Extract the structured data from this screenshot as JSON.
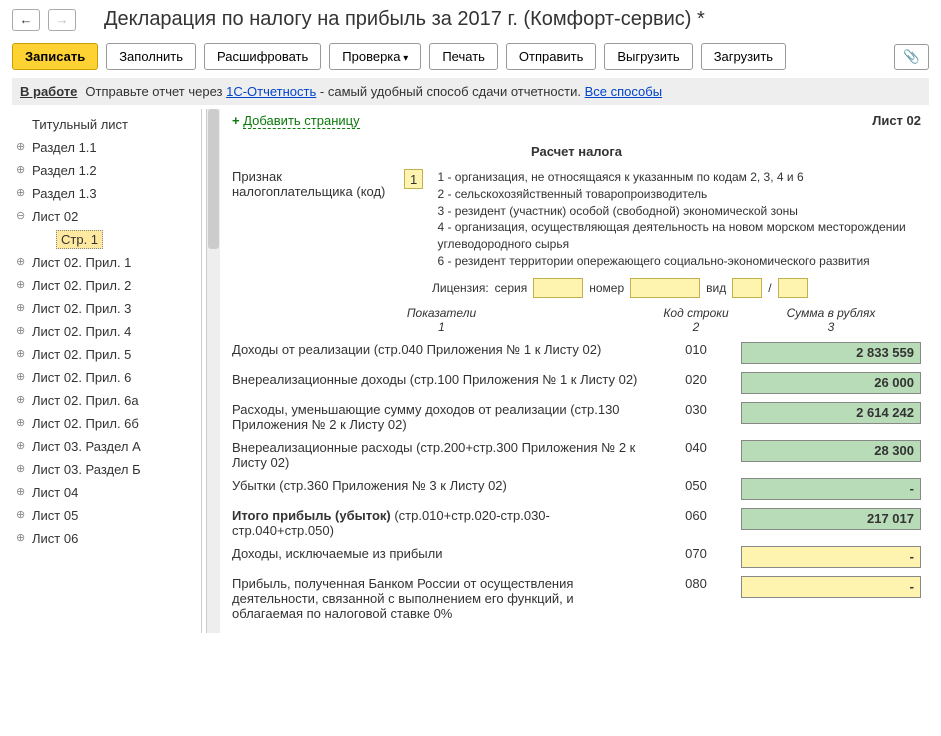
{
  "header": {
    "title": "Декларация по налогу на прибыль за 2017 г. (Комфорт-сервис) *"
  },
  "toolbar": {
    "write": "Записать",
    "fill": "Заполнить",
    "decode": "Расшифровать",
    "check": "Проверка",
    "print": "Печать",
    "send": "Отправить",
    "export": "Выгрузить",
    "import": "Загрузить"
  },
  "status": {
    "label": "В работе",
    "text1": "Отправьте отчет через ",
    "link1": "1С-Отчетность",
    "text2": " - самый удобный способ сдачи отчетности. ",
    "link2": "Все способы"
  },
  "sidebar": {
    "items": [
      "Титульный лист",
      "Раздел 1.1",
      "Раздел 1.2",
      "Раздел 1.3",
      "Лист 02",
      "Стр. 1",
      "Лист 02. Прил. 1",
      "Лист 02. Прил. 2",
      "Лист 02. Прил. 3",
      "Лист 02. Прил. 4",
      "Лист 02. Прил. 5",
      "Лист 02. Прил. 6",
      "Лист 02. Прил. 6а",
      "Лист 02. Прил. 6б",
      "Лист 03. Раздел А",
      "Лист 03. Раздел Б",
      "Лист 04",
      "Лист 05",
      "Лист 06"
    ]
  },
  "content": {
    "add_page": "Добавить страницу",
    "sheet": "Лист 02",
    "form_title": "Расчет налога",
    "taxpayer_label": "Признак налогоплательщика (код)",
    "taxpayer_code": "1",
    "codes": [
      "1 - организация, не относящаяся к указанным по кодам 2, 3, 4 и 6",
      "2 - сельскохозяйственный товаропроизводитель",
      "3 - резидент (участник) особой (свободной) экономической зоны",
      "4 - организация, осуществляющая деятельность на новом морском месторождении углеводородного сырья",
      "6 - резидент территории опережающего социально-экономического развития"
    ],
    "license": {
      "label": "Лицензия:",
      "seria": "серия",
      "number": "номер",
      "type": "вид",
      "slash": "/"
    },
    "headers": {
      "h1": "Показатели",
      "h1n": "1",
      "h2": "Код строки",
      "h2n": "2",
      "h3": "Сумма в рублях",
      "h3n": "3"
    },
    "rows": [
      {
        "label": "Доходы от реализации (стр.040 Приложения № 1 к Листу 02)",
        "code": "010",
        "val": "2 833 559",
        "cls": "green"
      },
      {
        "label": "Внереализационные доходы (стр.100 Приложения № 1 к Листу 02)",
        "code": "020",
        "val": "26 000",
        "cls": "green"
      },
      {
        "label": "Расходы, уменьшающие сумму доходов от реализации (стр.130 Приложения № 2 к Листу 02)",
        "code": "030",
        "val": "2 614 242",
        "cls": "green"
      },
      {
        "label": "Внереализационные расходы (стр.200+стр.300 Приложения № 2 к Листу 02)",
        "code": "040",
        "val": "28 300",
        "cls": "green"
      },
      {
        "label": "Убытки (стр.360 Приложения № 3 к Листу 02)",
        "code": "050",
        "val": "-",
        "cls": "green"
      },
      {
        "label_bold": "Итого прибыль (убыток)",
        "label_rest": "(стр.010+стр.020-стр.030-стр.040+стр.050)",
        "code": "060",
        "val": "217 017",
        "cls": "green"
      },
      {
        "label": "Доходы, исключаемые из прибыли",
        "code": "070",
        "val": "-",
        "cls": "yellow"
      },
      {
        "label": "Прибыль, полученная Банком России от осуществления деятельности, связанной с выполнением его функций, и облагаемая по налоговой ставке 0%",
        "code": "080",
        "val": "-",
        "cls": "yellow"
      }
    ]
  }
}
